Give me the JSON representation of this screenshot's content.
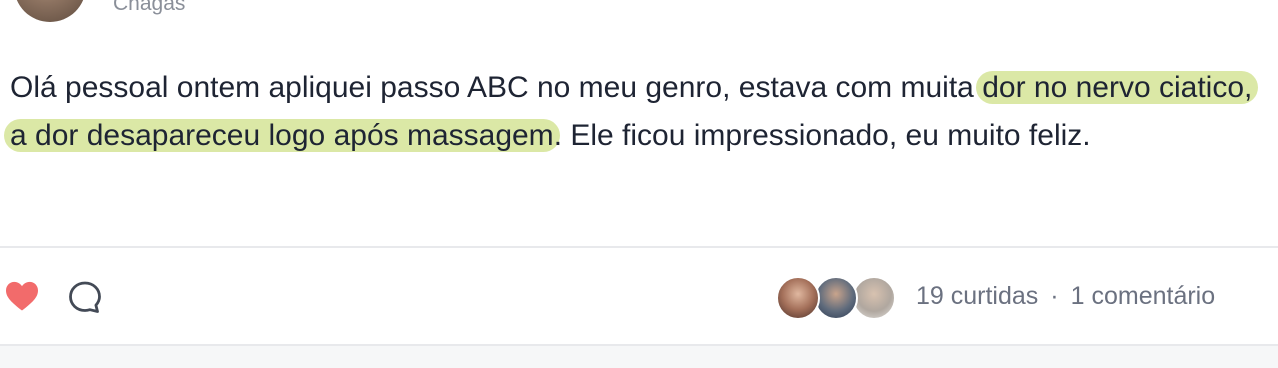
{
  "author": {
    "name": "Chagas"
  },
  "post": {
    "text_before": "Olá pessoal ontem apliquei passo ABC no meu genro, estava com muita ",
    "highlight": "dor no nervo ciatico, a dor desapareceu logo após massagem",
    "text_after": ". Ele ficou impressionado, eu muito feliz.",
    "highlight_color": "#dbe8a6"
  },
  "actions": {
    "like_icon": "heart-icon",
    "like_color": "#f26b6b",
    "comment_icon": "comment-bubble-icon"
  },
  "stats": {
    "likes": "19 curtidas",
    "separator": "·",
    "comments": "1 comentário"
  }
}
